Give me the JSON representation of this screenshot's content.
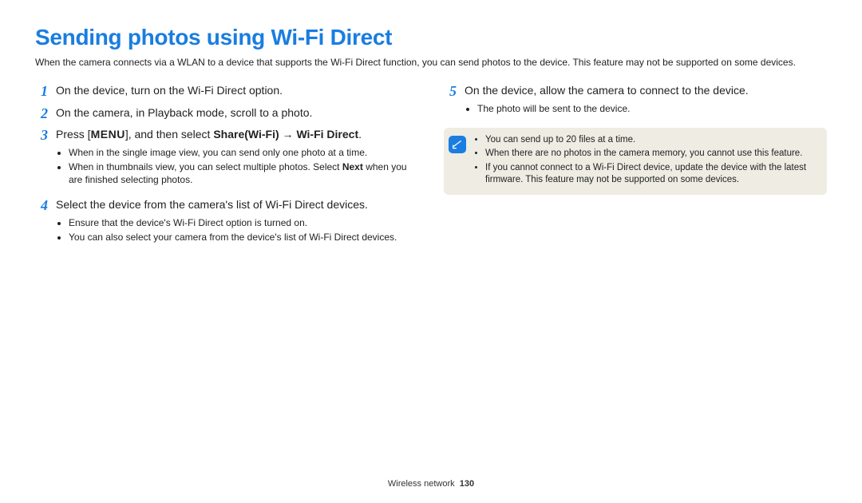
{
  "title": "Sending photos using Wi-Fi Direct",
  "intro": "When the camera connects via a WLAN to a device that supports the Wi-Fi Direct function, you can send photos to the device. This feature may not be supported on some devices.",
  "left": {
    "s1": {
      "num": "1",
      "text": "On the device, turn on the Wi-Fi Direct option."
    },
    "s2": {
      "num": "2",
      "text": "On the camera, in Playback mode, scroll to a photo."
    },
    "s3": {
      "num": "3",
      "pre": "Press [",
      "kbd": "MENU",
      "mid": "], and then select ",
      "b1": "Share(Wi-Fi)",
      "arrow": " → ",
      "b2": "Wi-Fi Direct",
      "post": ".",
      "sub1": "When in the single image view, you can send only one photo at a time.",
      "sub2a": "When in thumbnails view, you can select multiple photos. Select ",
      "sub2b": "Next",
      "sub2c": " when you are finished selecting photos."
    },
    "s4": {
      "num": "4",
      "text": "Select the device from the camera's list of Wi-Fi Direct devices.",
      "sub1": "Ensure that the device's Wi-Fi Direct option is turned on.",
      "sub2": "You can also select your camera from the device's list of Wi-Fi Direct devices."
    }
  },
  "right": {
    "s5": {
      "num": "5",
      "text": "On the device, allow the camera to connect to the device.",
      "sub1": "The photo will be sent to the device."
    },
    "info": {
      "b1": "You can send up to 20 files at a time.",
      "b2": "When there are no photos in the camera memory, you cannot use this feature.",
      "b3": "If you cannot connect to a Wi-Fi Direct device, update the device with the latest firmware. This feature may not be supported on some devices."
    }
  },
  "footer": {
    "section": "Wireless network",
    "page": "130"
  }
}
